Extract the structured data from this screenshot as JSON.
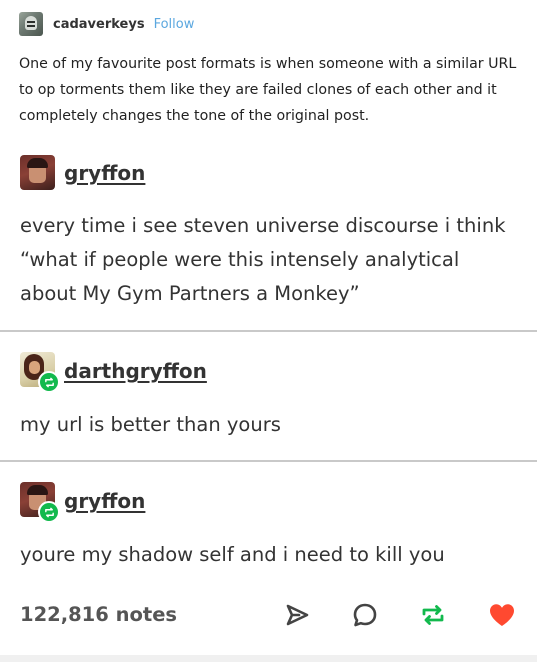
{
  "op": {
    "username": "cadaverkeys",
    "follow_label": "Follow",
    "body": "One of my favourite post formats is when someone with a similar URL to op torments them like they are failed clones of each other and it completely changes the tone of the original post."
  },
  "reblogs": [
    {
      "username": "gryffon",
      "avatar_icon": "user-avatar-red",
      "body": "every time i see steven universe discourse i think “what if people were this intensely analytical about My Gym Partners a Monkey”"
    },
    {
      "username": "darthgryffon",
      "avatar_icon": "user-avatar-cream",
      "body": "my url is better than yours"
    },
    {
      "username": "gryffon",
      "avatar_icon": "user-avatar-red",
      "body": "youre my shadow self and i need to kill you"
    }
  ],
  "footer": {
    "notes": "122,816 notes",
    "icons": [
      "share-icon",
      "reply-icon",
      "reblog-icon",
      "like-icon"
    ]
  },
  "colors": {
    "follow": "#5ba7df",
    "reblog_green": "#12b94d",
    "like_red": "#ff4930",
    "divider": "#c9c9c9"
  }
}
